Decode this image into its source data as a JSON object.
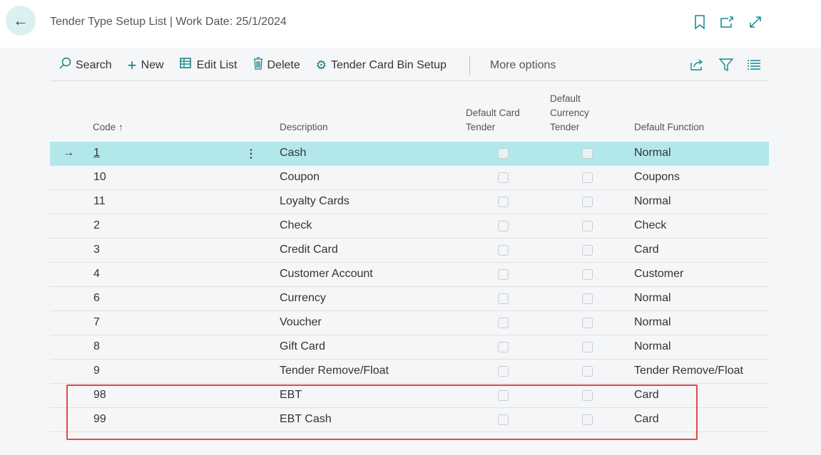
{
  "header": {
    "title": "Tender Type Setup List | Work Date: 25/1/2024"
  },
  "toolbar": {
    "search": "Search",
    "new": "New",
    "edit_list": "Edit List",
    "delete": "Delete",
    "bin_setup": "Tender Card Bin Setup",
    "more": "More options"
  },
  "columns": {
    "code": "Code",
    "sort_indicator": "↑",
    "description": "Description",
    "default_card_1": "Default Card",
    "default_card_2": "Tender",
    "default_currency_1": "Default",
    "default_currency_2": "Currency",
    "default_currency_3": "Tender",
    "default_function": "Default Function"
  },
  "rows": [
    {
      "code": "1",
      "description": "Cash",
      "function": "Normal"
    },
    {
      "code": "10",
      "description": "Coupon",
      "function": "Coupons"
    },
    {
      "code": "11",
      "description": "Loyalty Cards",
      "function": "Normal"
    },
    {
      "code": "2",
      "description": "Check",
      "function": "Check"
    },
    {
      "code": "3",
      "description": "Credit Card",
      "function": "Card"
    },
    {
      "code": "4",
      "description": "Customer Account",
      "function": "Customer"
    },
    {
      "code": "6",
      "description": "Currency",
      "function": "Normal"
    },
    {
      "code": "7",
      "description": "Voucher",
      "function": "Normal"
    },
    {
      "code": "8",
      "description": "Gift Card",
      "function": "Normal"
    },
    {
      "code": "9",
      "description": "Tender Remove/Float",
      "function": "Tender Remove/Float"
    },
    {
      "code": "98",
      "description": "EBT",
      "function": "Card"
    },
    {
      "code": "99",
      "description": "EBT Cash",
      "function": "Card"
    }
  ],
  "colors": {
    "accent": "#0f8a8f",
    "selected_row": "#b3e8eb",
    "highlight": "#e04848"
  }
}
